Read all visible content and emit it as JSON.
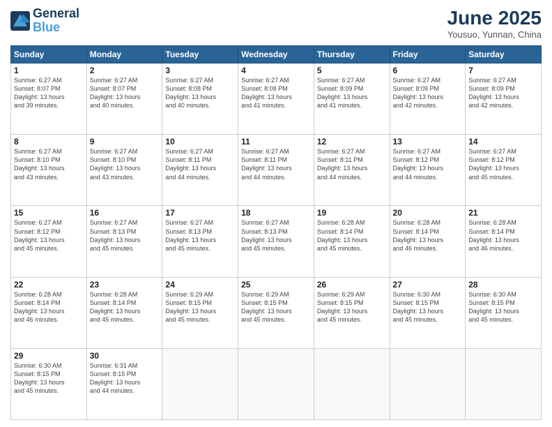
{
  "logo": {
    "line1": "General",
    "line2": "Blue"
  },
  "title": "June 2025",
  "location": "Yousuo, Yunnan, China",
  "days_of_week": [
    "Sunday",
    "Monday",
    "Tuesday",
    "Wednesday",
    "Thursday",
    "Friday",
    "Saturday"
  ],
  "weeks": [
    [
      {
        "day": "1",
        "info": "Sunrise: 6:27 AM\nSunset: 8:07 PM\nDaylight: 13 hours\nand 39 minutes."
      },
      {
        "day": "2",
        "info": "Sunrise: 6:27 AM\nSunset: 8:07 PM\nDaylight: 13 hours\nand 40 minutes."
      },
      {
        "day": "3",
        "info": "Sunrise: 6:27 AM\nSunset: 8:08 PM\nDaylight: 13 hours\nand 40 minutes."
      },
      {
        "day": "4",
        "info": "Sunrise: 6:27 AM\nSunset: 8:08 PM\nDaylight: 13 hours\nand 41 minutes."
      },
      {
        "day": "5",
        "info": "Sunrise: 6:27 AM\nSunset: 8:09 PM\nDaylight: 13 hours\nand 41 minutes."
      },
      {
        "day": "6",
        "info": "Sunrise: 6:27 AM\nSunset: 8:09 PM\nDaylight: 13 hours\nand 42 minutes."
      },
      {
        "day": "7",
        "info": "Sunrise: 6:27 AM\nSunset: 8:09 PM\nDaylight: 13 hours\nand 42 minutes."
      }
    ],
    [
      {
        "day": "8",
        "info": "Sunrise: 6:27 AM\nSunset: 8:10 PM\nDaylight: 13 hours\nand 43 minutes."
      },
      {
        "day": "9",
        "info": "Sunrise: 6:27 AM\nSunset: 8:10 PM\nDaylight: 13 hours\nand 43 minutes."
      },
      {
        "day": "10",
        "info": "Sunrise: 6:27 AM\nSunset: 8:11 PM\nDaylight: 13 hours\nand 44 minutes."
      },
      {
        "day": "11",
        "info": "Sunrise: 6:27 AM\nSunset: 8:11 PM\nDaylight: 13 hours\nand 44 minutes."
      },
      {
        "day": "12",
        "info": "Sunrise: 6:27 AM\nSunset: 8:11 PM\nDaylight: 13 hours\nand 44 minutes."
      },
      {
        "day": "13",
        "info": "Sunrise: 6:27 AM\nSunset: 8:12 PM\nDaylight: 13 hours\nand 44 minutes."
      },
      {
        "day": "14",
        "info": "Sunrise: 6:27 AM\nSunset: 8:12 PM\nDaylight: 13 hours\nand 45 minutes."
      }
    ],
    [
      {
        "day": "15",
        "info": "Sunrise: 6:27 AM\nSunset: 8:12 PM\nDaylight: 13 hours\nand 45 minutes."
      },
      {
        "day": "16",
        "info": "Sunrise: 6:27 AM\nSunset: 8:13 PM\nDaylight: 13 hours\nand 45 minutes."
      },
      {
        "day": "17",
        "info": "Sunrise: 6:27 AM\nSunset: 8:13 PM\nDaylight: 13 hours\nand 45 minutes."
      },
      {
        "day": "18",
        "info": "Sunrise: 6:27 AM\nSunset: 8:13 PM\nDaylight: 13 hours\nand 45 minutes."
      },
      {
        "day": "19",
        "info": "Sunrise: 6:28 AM\nSunset: 8:14 PM\nDaylight: 13 hours\nand 45 minutes."
      },
      {
        "day": "20",
        "info": "Sunrise: 6:28 AM\nSunset: 8:14 PM\nDaylight: 13 hours\nand 46 minutes."
      },
      {
        "day": "21",
        "info": "Sunrise: 6:28 AM\nSunset: 8:14 PM\nDaylight: 13 hours\nand 46 minutes."
      }
    ],
    [
      {
        "day": "22",
        "info": "Sunrise: 6:28 AM\nSunset: 8:14 PM\nDaylight: 13 hours\nand 46 minutes."
      },
      {
        "day": "23",
        "info": "Sunrise: 6:28 AM\nSunset: 8:14 PM\nDaylight: 13 hours\nand 45 minutes."
      },
      {
        "day": "24",
        "info": "Sunrise: 6:29 AM\nSunset: 8:15 PM\nDaylight: 13 hours\nand 45 minutes."
      },
      {
        "day": "25",
        "info": "Sunrise: 6:29 AM\nSunset: 8:15 PM\nDaylight: 13 hours\nand 45 minutes."
      },
      {
        "day": "26",
        "info": "Sunrise: 6:29 AM\nSunset: 8:15 PM\nDaylight: 13 hours\nand 45 minutes."
      },
      {
        "day": "27",
        "info": "Sunrise: 6:30 AM\nSunset: 8:15 PM\nDaylight: 13 hours\nand 45 minutes."
      },
      {
        "day": "28",
        "info": "Sunrise: 6:30 AM\nSunset: 8:15 PM\nDaylight: 13 hours\nand 45 minutes."
      }
    ],
    [
      {
        "day": "29",
        "info": "Sunrise: 6:30 AM\nSunset: 8:15 PM\nDaylight: 13 hours\nand 45 minutes."
      },
      {
        "day": "30",
        "info": "Sunrise: 6:31 AM\nSunset: 8:15 PM\nDaylight: 13 hours\nand 44 minutes."
      },
      {
        "day": "",
        "info": ""
      },
      {
        "day": "",
        "info": ""
      },
      {
        "day": "",
        "info": ""
      },
      {
        "day": "",
        "info": ""
      },
      {
        "day": "",
        "info": ""
      }
    ]
  ]
}
